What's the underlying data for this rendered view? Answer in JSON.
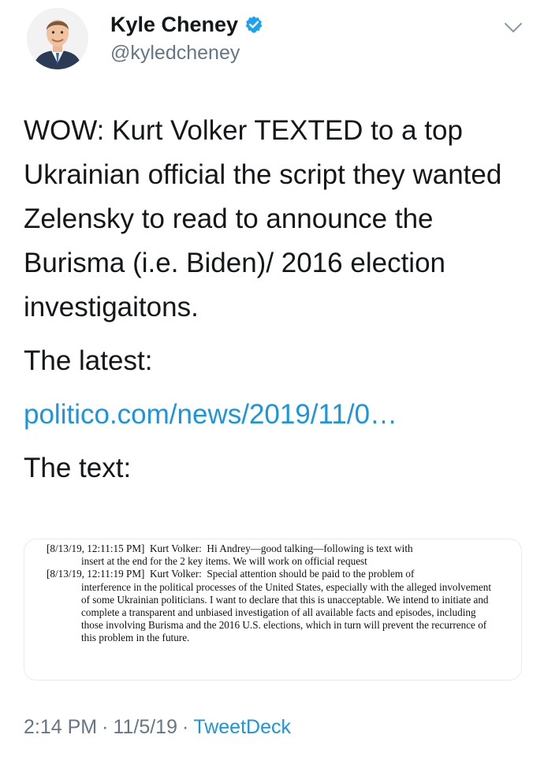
{
  "author": {
    "name": "Kyle Cheney",
    "handle": "@kyledcheney",
    "verified_color": "#1da1f2",
    "avatar_icon": "avatar-photo"
  },
  "tweet": {
    "text_main": "WOW: Kurt Volker TEXTED to a top Ukrainian official the script they wanted Zelensky to read to announce the Burisma (i.e. Biden)/ 2016 election investigaitons.",
    "text_latest": "The latest:",
    "link": "politico.com/news/2019/11/0…",
    "text_label": "The text:",
    "time": "2:14 PM",
    "date": "11/5/19",
    "separator": "·",
    "source": "TweetDeck"
  },
  "document": {
    "entries": [
      {
        "first_line": "[8/13/19, 12:11:15 PM]  Kurt Volker:  Hi Andrey—good talking—following is text with",
        "continuation": "insert at the end for the 2 key items.  We will work on official request"
      },
      {
        "first_line": "[8/13/19, 12:11:19 PM]  Kurt Volker:  Special attention should be paid to the problem of",
        "continuation": "interference in the political processes of the United States, especially with the alleged involvement of some Ukrainian politicians. I want to declare that this is unacceptable.  We intend to initiate and complete a transparent and unbiased investigation of all available facts and episodes, including those involving Burisma and the 2016 U.S. elections, which in turn will prevent the recurrence of this problem in the future."
      }
    ]
  },
  "colors": {
    "link": "#1b95e0",
    "secondary_text": "#657786",
    "primary_text": "#14171a",
    "card_border": "#e6ecf0"
  }
}
